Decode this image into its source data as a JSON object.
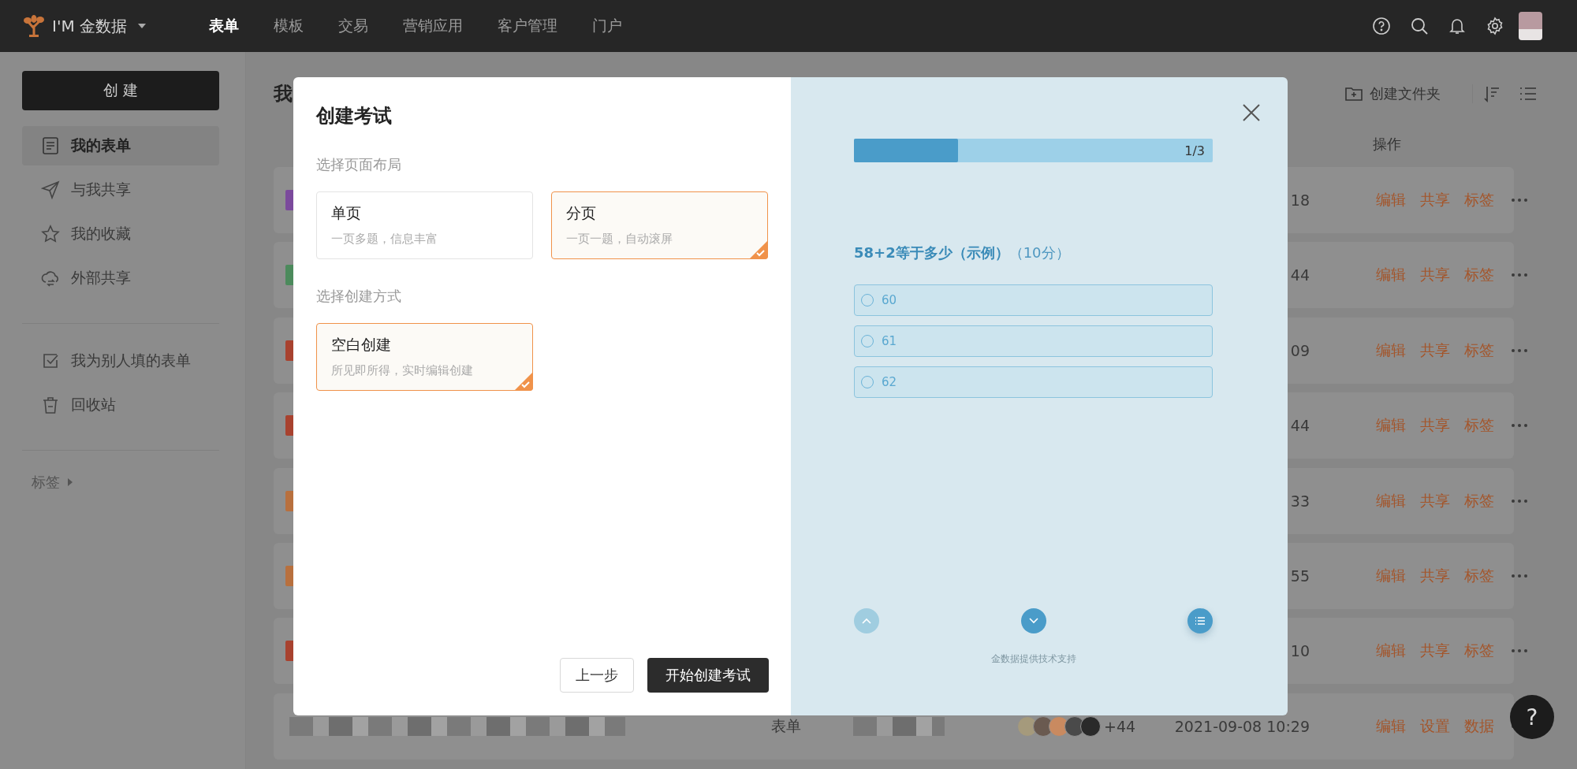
{
  "topbar": {
    "brand": "I'M 金数据",
    "nav": [
      {
        "label": "表单",
        "selected": true
      },
      {
        "label": "模板",
        "selected": false
      },
      {
        "label": "交易",
        "selected": false
      },
      {
        "label": "营销应用",
        "selected": false
      },
      {
        "label": "客户管理",
        "selected": false
      },
      {
        "label": "门户",
        "selected": false
      }
    ]
  },
  "sidebar": {
    "create_button": "创 建",
    "groups": [
      {
        "items": [
          {
            "label": "我的表单",
            "selected": true
          },
          {
            "label": "与我共享",
            "selected": false
          },
          {
            "label": "我的收藏",
            "selected": false
          },
          {
            "label": "外部共享",
            "selected": false
          }
        ]
      },
      {
        "items": [
          {
            "label": "我为别人填的表单",
            "selected": false
          },
          {
            "label": "回收站",
            "selected": false
          }
        ]
      }
    ],
    "tags": "标签"
  },
  "main": {
    "title": "我",
    "create_folder": "创建文件夹",
    "actions_header": "操作",
    "rows": [
      {
        "kind": "partial",
        "color": "#7b4a9c",
        "time": "18",
        "actions": [
          "编辑",
          "共享",
          "标签"
        ]
      },
      {
        "kind": "partial",
        "color": "#4c8a5c",
        "time": "44",
        "actions": [
          "编辑",
          "共享",
          "标签"
        ]
      },
      {
        "kind": "partial",
        "color": "#a8422f",
        "time": "09",
        "actions": [
          "编辑",
          "共享",
          "标签"
        ]
      },
      {
        "kind": "partial",
        "color": "#a8422f",
        "time": "44",
        "actions": [
          "编辑",
          "共享",
          "标签"
        ]
      },
      {
        "kind": "partial",
        "color": "#b8703e",
        "time": "33",
        "actions": [
          "编辑",
          "共享",
          "标签"
        ]
      },
      {
        "kind": "partial",
        "color": "#b8703e",
        "time": "55",
        "actions": [
          "编辑",
          "共享",
          "标签"
        ]
      },
      {
        "kind": "partial",
        "color": "#a8422f",
        "time": "10",
        "actions": [
          "编辑",
          "共享",
          "标签"
        ]
      },
      {
        "kind": "full",
        "type": "表单",
        "member_count": "+44",
        "time": "2021-09-08 10:29",
        "actions": [
          "编辑",
          "设置",
          "数据"
        ]
      }
    ]
  },
  "modal": {
    "title": "创建考试",
    "layout_label": "选择页面布局",
    "layout_options": [
      {
        "title": "单页",
        "desc": "一页多题，信息丰富",
        "selected": false
      },
      {
        "title": "分页",
        "desc": "一页一题，自动滚屏",
        "selected": true
      }
    ],
    "method_label": "选择创建方式",
    "method_options": [
      {
        "title": "空白创建",
        "desc": "所见即所得，实时编辑创建",
        "selected": true
      }
    ],
    "back_button": "上一步",
    "start_button": "开始创建考试",
    "preview": {
      "progress": {
        "level": 0.29,
        "text": "1/3"
      },
      "question": "58+2等于多少（示例）",
      "score": "（10分）",
      "options": [
        {
          "label": "60",
          "selected": false
        },
        {
          "label": "61",
          "selected": false
        },
        {
          "label": "62",
          "selected": false
        }
      ],
      "nav": [
        {
          "kind": "up",
          "disabled": true
        },
        {
          "kind": "down",
          "disabled": false
        },
        {
          "kind": "list",
          "disabled": false
        }
      ],
      "footer": "金数据提供技术支持"
    }
  },
  "help_button": "?"
}
